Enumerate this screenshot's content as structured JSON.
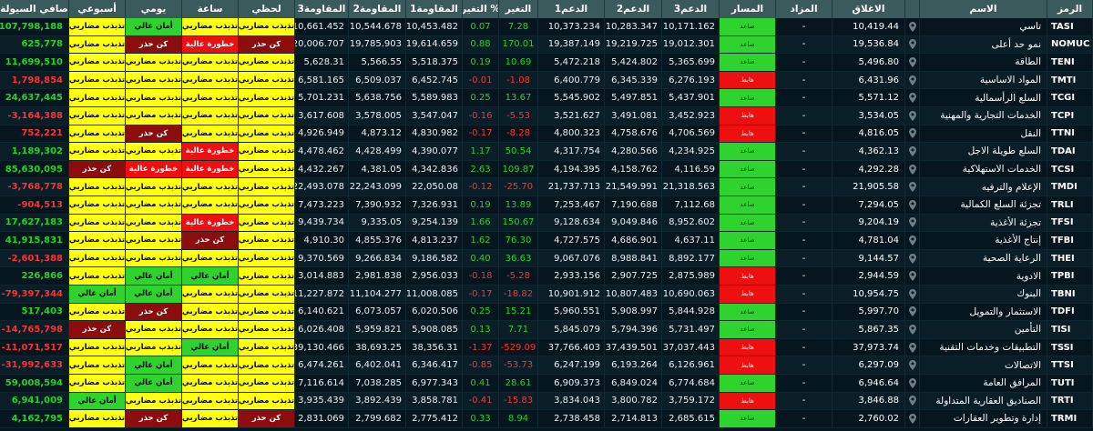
{
  "headers": {
    "liquidity": "صافي السيولة",
    "weekly": "أسبوعي",
    "daily": "يومي",
    "hourly": "ساعة",
    "instant": "لحظي",
    "res3": "المقاومة3",
    "res2": "المقاومة2",
    "res1": "المقاومة1",
    "change_pct": "التغير %",
    "change": "التغير",
    "sup1": "الدعم1",
    "sup2": "الدعم2",
    "sup3": "الدعم3",
    "trend": "المسار",
    "auction": "المزاد",
    "close": "الاغلاق",
    "name": "الاسم",
    "symbol": "الرمز"
  },
  "colors": {
    "positive": "#22d622",
    "negative": "#ff3030",
    "signal_speculative": "#ffff10",
    "signal_safe": "#2ed32e",
    "signal_caution": "#8b0d0d",
    "signal_high_risk": "#ee1010",
    "trend_up": "#2ed32e",
    "trend_down": "#ee1010"
  },
  "rows": [
    {
      "symbol": "TASI",
      "name": "تاسي",
      "close": "10,419.44",
      "auction": "-",
      "trend": "صاعد",
      "sup3": "10,171.162",
      "sup2": "10,283.347",
      "sup1": "10,373.234",
      "change": "7.28",
      "change_pct": "0.07",
      "res1": "10,453.482",
      "res2": "10,544.678",
      "res3": "10,661.452",
      "instant": "تذبذب مضاربي",
      "hourly": "تذبذب مضاربي",
      "daily": "أمان عالي",
      "weekly": "تذبذب مضاربي",
      "liquidity": "107,798,188",
      "dir": "pos"
    },
    {
      "symbol": "NOMUC",
      "name": "نمو حد أعلى",
      "close": "19,536.84",
      "auction": "-",
      "trend": "صاعد",
      "sup3": "19,012.301",
      "sup2": "19,219.725",
      "sup1": "19,387.149",
      "change": "170.01",
      "change_pct": "0.88",
      "res1": "19,614.659",
      "res2": "19,785.903",
      "res3": "20,006.707",
      "instant": "كن حذر",
      "hourly": "خطورة عالية",
      "daily": "كن حذر",
      "weekly": "تذبذب مضاربي",
      "liquidity": "625,778",
      "dir": "pos"
    },
    {
      "symbol": "TENI",
      "name": "الطاقة",
      "close": "5,496.80",
      "auction": "-",
      "trend": "صاعد",
      "sup3": "5,365.699",
      "sup2": "5,424.802",
      "sup1": "5,472.218",
      "change": "10.69",
      "change_pct": "0.19",
      "res1": "5,518.375",
      "res2": "5,566.55",
      "res3": "5,628.31",
      "instant": "تذبذب مضاربي",
      "hourly": "تذبذب مضاربي",
      "daily": "تذبذب مضاربي",
      "weekly": "تذبذب مضاربي",
      "liquidity": "11,699,510",
      "dir": "pos"
    },
    {
      "symbol": "TMTI",
      "name": "المواد الاساسية",
      "close": "6,431.96",
      "auction": "-",
      "trend": "هابط",
      "sup3": "6,276.193",
      "sup2": "6,345.339",
      "sup1": "6,400.779",
      "change": "-1.08",
      "change_pct": "-0.01",
      "res1": "6,452.745",
      "res2": "6,509.037",
      "res3": "6,581.165",
      "instant": "تذبذب مضاربي",
      "hourly": "تذبذب مضاربي",
      "daily": "تذبذب مضاربي",
      "weekly": "تذبذب مضاربي",
      "liquidity": "1,798,854",
      "dir": "neg"
    },
    {
      "symbol": "TCGI",
      "name": "السلع الرأسمالية",
      "close": "5,571.12",
      "auction": "-",
      "trend": "صاعد",
      "sup3": "5,437.901",
      "sup2": "5,497.851",
      "sup1": "5,545.902",
      "change": "13.67",
      "change_pct": "0.25",
      "res1": "5,589.983",
      "res2": "5,638.756",
      "res3": "5,701.231",
      "instant": "تذبذب مضاربي",
      "hourly": "تذبذب مضاربي",
      "daily": "تذبذب مضاربي",
      "weekly": "تذبذب مضاربي",
      "liquidity": "24,637,445",
      "dir": "pos"
    },
    {
      "symbol": "TCPI",
      "name": "الخدمات التجارية والمهنية",
      "close": "3,534.05",
      "auction": "-",
      "trend": "هابط",
      "sup3": "3,452.923",
      "sup2": "3,491.081",
      "sup1": "3,521.627",
      "change": "-5.53",
      "change_pct": "-0.16",
      "res1": "3,547.047",
      "res2": "3,578.005",
      "res3": "3,617.608",
      "instant": "تذبذب مضاربي",
      "hourly": "تذبذب مضاربي",
      "daily": "تذبذب مضاربي",
      "weekly": "تذبذب مضاربي",
      "liquidity": "-3,164,388",
      "dir": "neg"
    },
    {
      "symbol": "TTNI",
      "name": "النقل",
      "close": "4,816.05",
      "auction": "-",
      "trend": "هابط",
      "sup3": "4,706.569",
      "sup2": "4,758.676",
      "sup1": "4,800.323",
      "change": "-8.28",
      "change_pct": "-0.17",
      "res1": "4,830.982",
      "res2": "4,873.12",
      "res3": "4,926.949",
      "instant": "تذبذب مضاربي",
      "hourly": "تذبذب مضاربي",
      "daily": "كن حذر",
      "weekly": "تذبذب مضاربي",
      "liquidity": "752,221",
      "dir": "neg"
    },
    {
      "symbol": "TDAI",
      "name": "السلع طويلة الاجل",
      "close": "4,362.13",
      "auction": "-",
      "trend": "صاعد",
      "sup3": "4,234.925",
      "sup2": "4,280.566",
      "sup1": "4,317.754",
      "change": "50.54",
      "change_pct": "1.17",
      "res1": "4,390.077",
      "res2": "4,428.499",
      "res3": "4,478.462",
      "instant": "تذبذب مضاربي",
      "hourly": "خطورة عالية",
      "daily": "تذبذب مضاربي",
      "weekly": "تذبذب مضاربي",
      "liquidity": "1,189,302",
      "dir": "pos"
    },
    {
      "symbol": "TCSI",
      "name": "الخدمات الاستهلاكية",
      "close": "4,292.28",
      "auction": "-",
      "trend": "صاعد",
      "sup3": "4,116.59",
      "sup2": "4,158.762",
      "sup1": "4,194.395",
      "change": "109.87",
      "change_pct": "2.63",
      "res1": "4,342.836",
      "res2": "4,381.05",
      "res3": "4,432.267",
      "instant": "تذبذب مضاربي",
      "hourly": "خطورة عالية",
      "daily": "خطورة عالية",
      "weekly": "كن حذر",
      "liquidity": "85,630,095",
      "dir": "pos"
    },
    {
      "symbol": "TMDI",
      "name": "الإعلام والترفيه",
      "close": "21,905.58",
      "auction": "-",
      "trend": "صاعد",
      "sup3": "21,318.563",
      "sup2": "21,549.991",
      "sup1": "21,737.713",
      "change": "-25.70",
      "change_pct": "-0.12",
      "res1": "22,050.08",
      "res2": "22,243.099",
      "res3": "22,493.078",
      "instant": "تذبذب مضاربي",
      "hourly": "تذبذب مضاربي",
      "daily": "تذبذب مضاربي",
      "weekly": "تذبذب مضاربي",
      "liquidity": "-3,768,778",
      "dir": "neg"
    },
    {
      "symbol": "TRLI",
      "name": "تجزئة السلع الكمالية",
      "close": "7,294.05",
      "auction": "-",
      "trend": "صاعد",
      "sup3": "7,112.68",
      "sup2": "7,190.688",
      "sup1": "7,253.467",
      "change": "13.89",
      "change_pct": "0.19",
      "res1": "7,326.931",
      "res2": "7,390.932",
      "res3": "7,473.223",
      "instant": "تذبذب مضاربي",
      "hourly": "تذبذب مضاربي",
      "daily": "تذبذب مضاربي",
      "weekly": "تذبذب مضاربي",
      "liquidity": "-904,513",
      "dir": "neg"
    },
    {
      "symbol": "TFSI",
      "name": "تجزئة الأغذية",
      "close": "9,204.19",
      "auction": "-",
      "trend": "صاعد",
      "sup3": "8,952.602",
      "sup2": "9,049.846",
      "sup1": "9,128.634",
      "change": "150.67",
      "change_pct": "1.66",
      "res1": "9,254.139",
      "res2": "9,335.05",
      "res3": "9,439.734",
      "instant": "تذبذب مضاربي",
      "hourly": "خطورة عالية",
      "daily": "تذبذب مضاربي",
      "weekly": "تذبذب مضاربي",
      "liquidity": "17,627,183",
      "dir": "pos"
    },
    {
      "symbol": "TFBI",
      "name": "إنتاج الأغذية",
      "close": "4,781.04",
      "auction": "-",
      "trend": "صاعد",
      "sup3": "4,637.11",
      "sup2": "4,686.901",
      "sup1": "4,727.575",
      "change": "76.30",
      "change_pct": "1.62",
      "res1": "4,813.237",
      "res2": "4,855.376",
      "res3": "4,910.30",
      "instant": "تذبذب مضاربي",
      "hourly": "كن حذر",
      "daily": "تذبذب مضاربي",
      "weekly": "تذبذب مضاربي",
      "liquidity": "41,915,831",
      "dir": "pos"
    },
    {
      "symbol": "THEI",
      "name": "الرعاية الصحية",
      "close": "9,144.57",
      "auction": "-",
      "trend": "صاعد",
      "sup3": "8,892.177",
      "sup2": "8,988.841",
      "sup1": "9,067.076",
      "change": "36.63",
      "change_pct": "0.40",
      "res1": "9,186.582",
      "res2": "9,266.834",
      "res3": "9,370.569",
      "instant": "تذبذب مضاربي",
      "hourly": "تذبذب مضاربي",
      "daily": "تذبذب مضاربي",
      "weekly": "تذبذب مضاربي",
      "liquidity": "-2,601,388",
      "dir": "neg"
    },
    {
      "symbol": "TPBI",
      "name": "الادوية",
      "close": "2,944.59",
      "auction": "-",
      "trend": "هابط",
      "sup3": "2,875.989",
      "sup2": "2,907.725",
      "sup1": "2,933.156",
      "change": "-5.28",
      "change_pct": "-0.18",
      "res1": "2,956.033",
      "res2": "2,981.838",
      "res3": "3,014.883",
      "instant": "تذبذب مضاربي",
      "hourly": "أمان عالي",
      "daily": "أمان عالي",
      "weekly": "تذبذب مضاربي",
      "liquidity": "226,866",
      "dir": "pos"
    },
    {
      "symbol": "TBNI",
      "name": "البنوك",
      "close": "10,954.75",
      "auction": "-",
      "trend": "هابط",
      "sup3": "10,690.063",
      "sup2": "10,807.483",
      "sup1": "10,901.912",
      "change": "-18.82",
      "change_pct": "-0.17",
      "res1": "11,008.085",
      "res2": "11,104.277",
      "res3": "11,227.872",
      "instant": "تذبذب مضاربي",
      "hourly": "تذبذب مضاربي",
      "daily": "أمان عالي",
      "weekly": "أمان عالي",
      "liquidity": "-79,397,344",
      "dir": "neg"
    },
    {
      "symbol": "TDFI",
      "name": "الاستثمار والتمويل",
      "close": "5,997.70",
      "auction": "-",
      "trend": "صاعد",
      "sup3": "5,844.928",
      "sup2": "5,908.997",
      "sup1": "5,960.551",
      "change": "15.21",
      "change_pct": "0.25",
      "res1": "6,020.506",
      "res2": "6,073.057",
      "res3": "6,140.621",
      "instant": "تذبذب مضاربي",
      "hourly": "تذبذب مضاربي",
      "daily": "كن حذر",
      "weekly": "تذبذب مضاربي",
      "liquidity": "517,403",
      "dir": "pos"
    },
    {
      "symbol": "TISI",
      "name": "التأمين",
      "close": "5,867.35",
      "auction": "-",
      "trend": "صاعد",
      "sup3": "5,731.497",
      "sup2": "5,794.396",
      "sup1": "5,845.079",
      "change": "7.71",
      "change_pct": "0.13",
      "res1": "5,908.085",
      "res2": "5,959.821",
      "res3": "6,026.408",
      "instant": "تذبذب مضاربي",
      "hourly": "تذبذب مضاربي",
      "daily": "تذبذب مضاربي",
      "weekly": "كن حذر",
      "liquidity": "-14,765,798",
      "dir": "neg"
    },
    {
      "symbol": "TSSI",
      "name": "التطبيقات وخدمات التقنية",
      "close": "37,973.74",
      "auction": "-",
      "trend": "هابط",
      "sup3": "37,037.443",
      "sup2": "37,439.501",
      "sup1": "37,766.403",
      "change": "-529.09",
      "change_pct": "-1.37",
      "res1": "38,356.31",
      "res2": "38,693.25",
      "res3": "39,130.466",
      "instant": "تذبذب مضاربي",
      "hourly": "أمان عالي",
      "daily": "تذبذب مضاربي",
      "weekly": "تذبذب مضاربي",
      "liquidity": "-11,071,517",
      "dir": "neg"
    },
    {
      "symbol": "TTSI",
      "name": "الاتصالات",
      "close": "6,297.09",
      "auction": "-",
      "trend": "هابط",
      "sup3": "6,126.961",
      "sup2": "6,193.264",
      "sup1": "6,247.199",
      "change": "-53.73",
      "change_pct": "-0.85",
      "res1": "6,346.417",
      "res2": "6,402.041",
      "res3": "6,474.261",
      "instant": "تذبذب مضاربي",
      "hourly": "تذبذب مضاربي",
      "daily": "أمان عالي",
      "weekly": "تذبذب مضاربي",
      "liquidity": "-31,992,633",
      "dir": "neg"
    },
    {
      "symbol": "TUTI",
      "name": "المرافق العامة",
      "close": "6,946.64",
      "auction": "-",
      "trend": "صاعد",
      "sup3": "6,774.684",
      "sup2": "6,849.024",
      "sup1": "6,909.373",
      "change": "28.61",
      "change_pct": "0.41",
      "res1": "6,977.343",
      "res2": "7,038.285",
      "res3": "7,116.614",
      "instant": "تذبذب مضاربي",
      "hourly": "تذبذب مضاربي",
      "daily": "أمان عالي",
      "weekly": "تذبذب مضاربي",
      "liquidity": "59,008,594",
      "dir": "pos"
    },
    {
      "symbol": "TRTI",
      "name": "الصناديق العقارية المتداولة",
      "close": "3,846.88",
      "auction": "-",
      "trend": "هابط",
      "sup3": "3,759.172",
      "sup2": "3,800.782",
      "sup1": "3,834.043",
      "change": "-15.83",
      "change_pct": "-0.41",
      "res1": "3,858.781",
      "res2": "3,892.439",
      "res3": "3,935.439",
      "instant": "تذبذب مضاربي",
      "hourly": "تذبذب مضاربي",
      "daily": "تذبذب مضاربي",
      "weekly": "أمان عالي",
      "liquidity": "6,941,009",
      "dir": "pos"
    },
    {
      "symbol": "TRMI",
      "name": "إدارة وتطوير العقارات",
      "close": "2,760.02",
      "auction": "-",
      "trend": "صاعد",
      "sup3": "2,685.615",
      "sup2": "2,714.813",
      "sup1": "2,738.458",
      "change": "8.94",
      "change_pct": "0.33",
      "res1": "2,775.412",
      "res2": "2,799.682",
      "res3": "2,831.069",
      "instant": "كن حذر",
      "hourly": "تذبذب مضاربي",
      "daily": "كن حذر",
      "weekly": "تذبذب مضاربي",
      "liquidity": "4,162,795",
      "dir": "pos"
    }
  ]
}
